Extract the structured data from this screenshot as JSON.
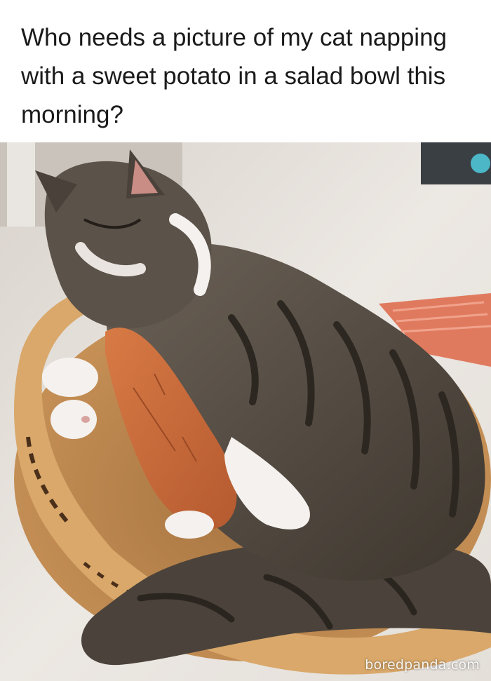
{
  "caption": "Who needs a picture of my cat napping with a sweet potato in a salad bowl this morning?",
  "photo": {
    "subjects": [
      "cat",
      "sweet-potato",
      "wooden-bowl",
      "countertop",
      "cloth"
    ],
    "colors": {
      "countertop": "#ebe7e2",
      "bowl": "#b7864f",
      "bowl_rim": "#d9a86a",
      "sweet_potato": "#c8683a",
      "cat_fur": "#5a5148",
      "cat_white": "#f4f1ee",
      "cloth": "#e07a5f"
    }
  },
  "watermark": "boredpanda.com"
}
